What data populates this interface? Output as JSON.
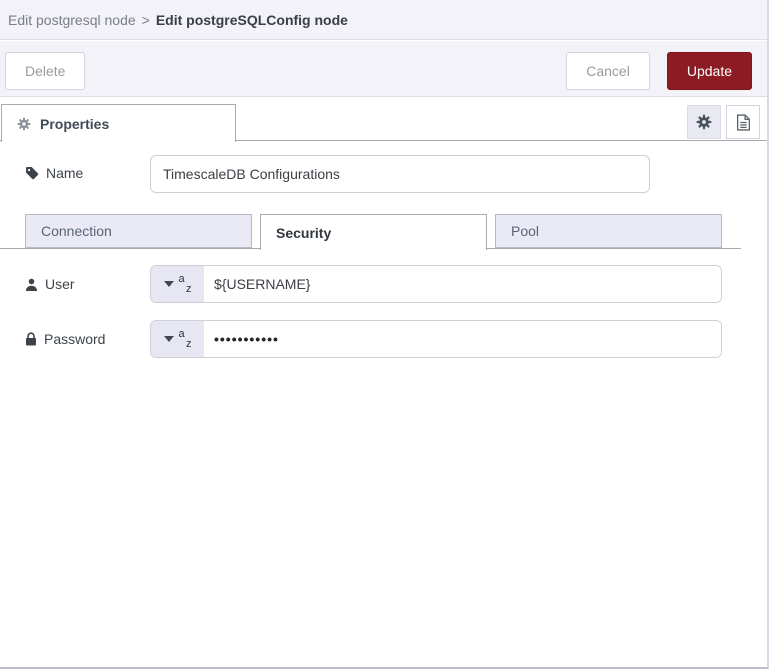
{
  "breadcrumb": {
    "parent": "Edit postgresql node",
    "separator": ">",
    "current": "Edit postgreSQLConfig node"
  },
  "toolbar": {
    "delete": "Delete",
    "cancel": "Cancel",
    "update": "Update"
  },
  "properties_tab": {
    "label": "Properties"
  },
  "typed_input": {
    "letter_top": "a",
    "letter_bottom": "z"
  },
  "form": {
    "name_field": {
      "label": "Name",
      "value": "TimescaleDB Configurations"
    },
    "config_tabs": {
      "connection": "Connection",
      "security": "Security",
      "pool": "Pool",
      "active": "Security"
    },
    "user_field": {
      "label": "User",
      "type": "string",
      "value": "${USERNAME}"
    },
    "password_field": {
      "label": "Password",
      "type": "string",
      "value": "•••••••••••"
    }
  },
  "icons": [
    "gear-icon",
    "file-icon",
    "tag-icon",
    "user-icon",
    "lock-icon",
    "caret-down-icon",
    "az-type-icon"
  ],
  "colors": {
    "panel_bg": "#f2f2f8",
    "update_button_bg": "#8c1b23",
    "tab_inactive_bg": "#e9eaf5",
    "border_strong": "#a9a9b2",
    "border_light": "#cfcfd8",
    "typed_button_bg": "#e7e7f3"
  }
}
